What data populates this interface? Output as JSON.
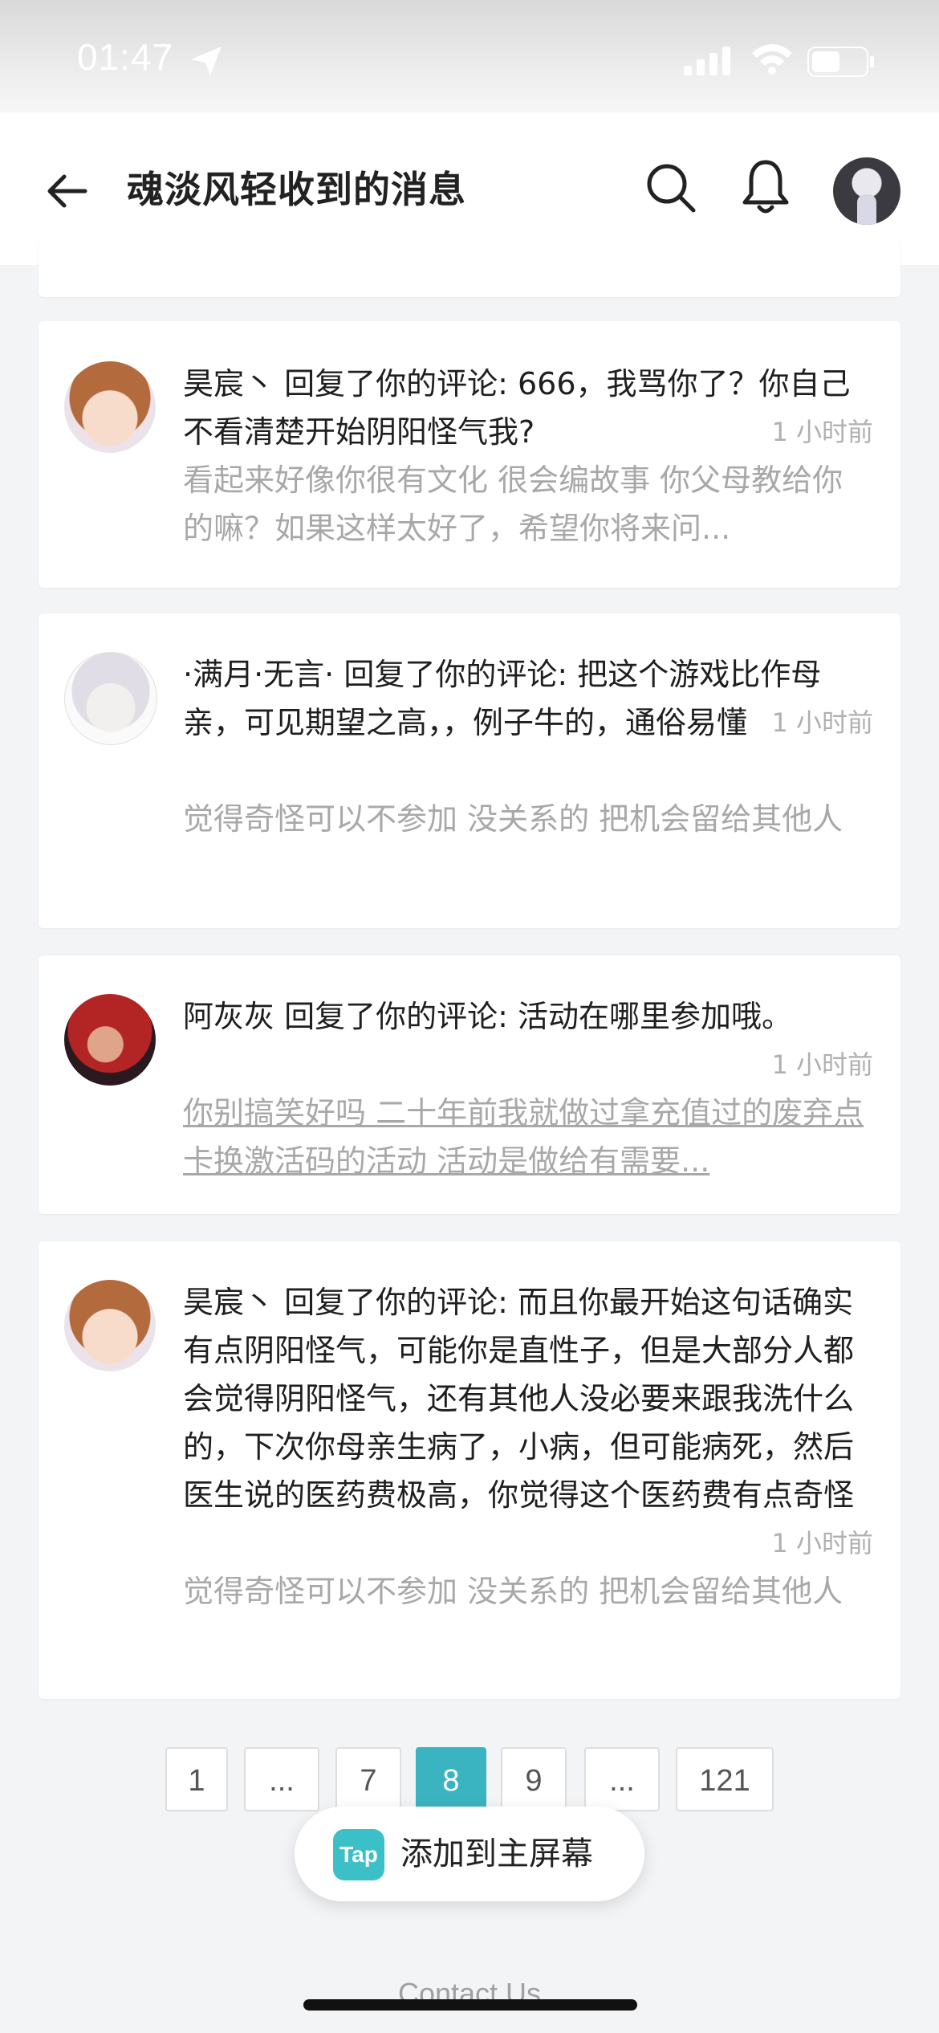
{
  "status_bar": {
    "time": "01:47"
  },
  "header": {
    "title": "魂淡风轻收到的消息"
  },
  "messages": [
    {
      "user": "昊宸丶",
      "action": " 回复了你的评论: ",
      "text": "666，我骂你了？你自己不看清楚开始阴阳怪气我?",
      "time": "1 小时前",
      "quote": "看起来好像你很有文化 很会编故事 你父母教给你的嘛？如果这样太好了，希望你将来问..."
    },
    {
      "user": "·满月·无言·",
      "action": " 回复了你的评论: ",
      "text": "把这个游戏比作母亲，可见期望之高，，例子牛的，通俗易懂",
      "time": "1 小时前",
      "quote": "觉得奇怪可以不参加 没关系的 把机会留给其他人"
    },
    {
      "user": "阿灰灰",
      "action": " 回复了你的评论: ",
      "text": "活动在哪里参加哦。",
      "time": "1 小时前",
      "quote": "你别搞笑好吗 二十年前我就做过拿充值过的废弃点卡换激活码的活动 活动是做给有需要..."
    },
    {
      "user": "昊宸丶",
      "action": " 回复了你的评论: ",
      "text": "而且你最开始这句话确实有点阴阳怪气，可能你是直性子，但是大部分人都会觉得阴阳怪气，还有其他人没必要来跟我洗什么的，下次你母亲生病了，小病，但可能病死，然后医生说的医药费极高，你觉得这个医药费有点奇怪",
      "time": "1 小时前",
      "quote": "觉得奇怪可以不参加 没关系的 把机会留给其他人"
    }
  ],
  "pagination": {
    "pages": [
      "1",
      "...",
      "7",
      "8",
      "9",
      "...",
      "121"
    ],
    "current": "8"
  },
  "add_to_home": {
    "logo": "Tap",
    "label": "添加到主屏幕"
  },
  "footer": {
    "contact": "Contact Us"
  },
  "colors": {
    "accent": "#3bb4c1",
    "muted_text": "#a8a8a8",
    "background": "#f3f4f6"
  },
  "icons": [
    "location-arrow-icon",
    "signal-icon",
    "wifi-icon",
    "battery-icon",
    "back-arrow-icon",
    "search-icon",
    "bell-icon"
  ]
}
